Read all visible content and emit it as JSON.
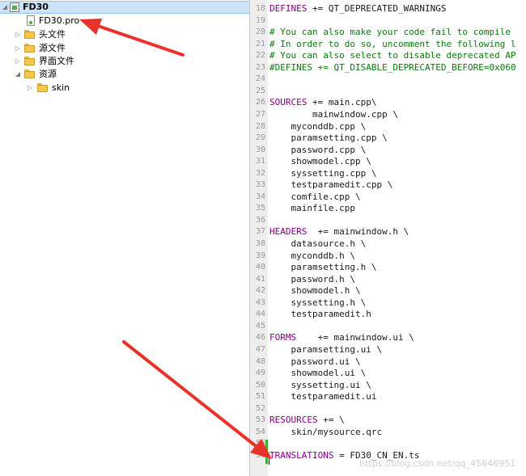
{
  "project_tree": {
    "root_label": "FD30",
    "items": [
      {
        "label": "FD30.pro",
        "icon": "pro-file-icon"
      },
      {
        "label": "头文件",
        "icon": "folder-icon"
      },
      {
        "label": "源文件",
        "icon": "folder-icon"
      },
      {
        "label": "界面文件",
        "icon": "folder-icon"
      },
      {
        "label": "资源",
        "icon": "folder-icon"
      },
      {
        "label": "skin",
        "icon": "folder-icon"
      }
    ]
  },
  "editor": {
    "lines": [
      {
        "num": "18",
        "text": "DEFINES += QT_DEPRECATED_WARNINGS"
      },
      {
        "num": "19",
        "text": ""
      },
      {
        "num": "20",
        "text": "# You can also make your code fail to compile"
      },
      {
        "num": "21",
        "text": "# In order to do so, uncomment the following l"
      },
      {
        "num": "22",
        "text": "# You can also select to disable deprecated AP"
      },
      {
        "num": "23",
        "text": "#DEFINES += QT_DISABLE_DEPRECATED_BEFORE=0x060"
      },
      {
        "num": "24",
        "text": ""
      },
      {
        "num": "25",
        "text": ""
      },
      {
        "num": "26",
        "text": "SOURCES += main.cpp\\"
      },
      {
        "num": "27",
        "text": "        mainwindow.cpp \\"
      },
      {
        "num": "28",
        "text": "    myconddb.cpp \\"
      },
      {
        "num": "29",
        "text": "    paramsetting.cpp \\"
      },
      {
        "num": "30",
        "text": "    password.cpp \\"
      },
      {
        "num": "31",
        "text": "    showmodel.cpp \\"
      },
      {
        "num": "32",
        "text": "    syssetting.cpp \\"
      },
      {
        "num": "33",
        "text": "    testparamedit.cpp \\"
      },
      {
        "num": "34",
        "text": "    comfile.cpp \\"
      },
      {
        "num": "35",
        "text": "    mainfile.cpp"
      },
      {
        "num": "36",
        "text": ""
      },
      {
        "num": "37",
        "text": "HEADERS  += mainwindow.h \\"
      },
      {
        "num": "38",
        "text": "    datasource.h \\"
      },
      {
        "num": "39",
        "text": "    myconddb.h \\"
      },
      {
        "num": "40",
        "text": "    paramsetting.h \\"
      },
      {
        "num": "41",
        "text": "    password.h \\"
      },
      {
        "num": "42",
        "text": "    showmodel.h \\"
      },
      {
        "num": "43",
        "text": "    syssetting.h \\"
      },
      {
        "num": "44",
        "text": "    testparamedit.h"
      },
      {
        "num": "45",
        "text": ""
      },
      {
        "num": "46",
        "text": "FORMS    += mainwindow.ui \\"
      },
      {
        "num": "47",
        "text": "    paramsetting.ui \\"
      },
      {
        "num": "48",
        "text": "    password.ui \\"
      },
      {
        "num": "49",
        "text": "    showmodel.ui \\"
      },
      {
        "num": "50",
        "text": "    syssetting.ui \\"
      },
      {
        "num": "51",
        "text": "    testparamedit.ui"
      },
      {
        "num": "52",
        "text": ""
      },
      {
        "num": "53",
        "text": "RESOURCES += \\"
      },
      {
        "num": "54",
        "text": "    skin/mysource.qrc"
      },
      {
        "num": "55",
        "text": ""
      },
      {
        "num": "56",
        "text": "TRANSLATIONS = FD30_CN_EN.ts"
      }
    ]
  },
  "watermark": "https://blog.csdn.net/qq_45646951",
  "colors": {
    "keyword": "#800080",
    "comment": "#0a7a0a",
    "annotation_arrow": "#e8322a",
    "selection": "#cde3f7"
  }
}
